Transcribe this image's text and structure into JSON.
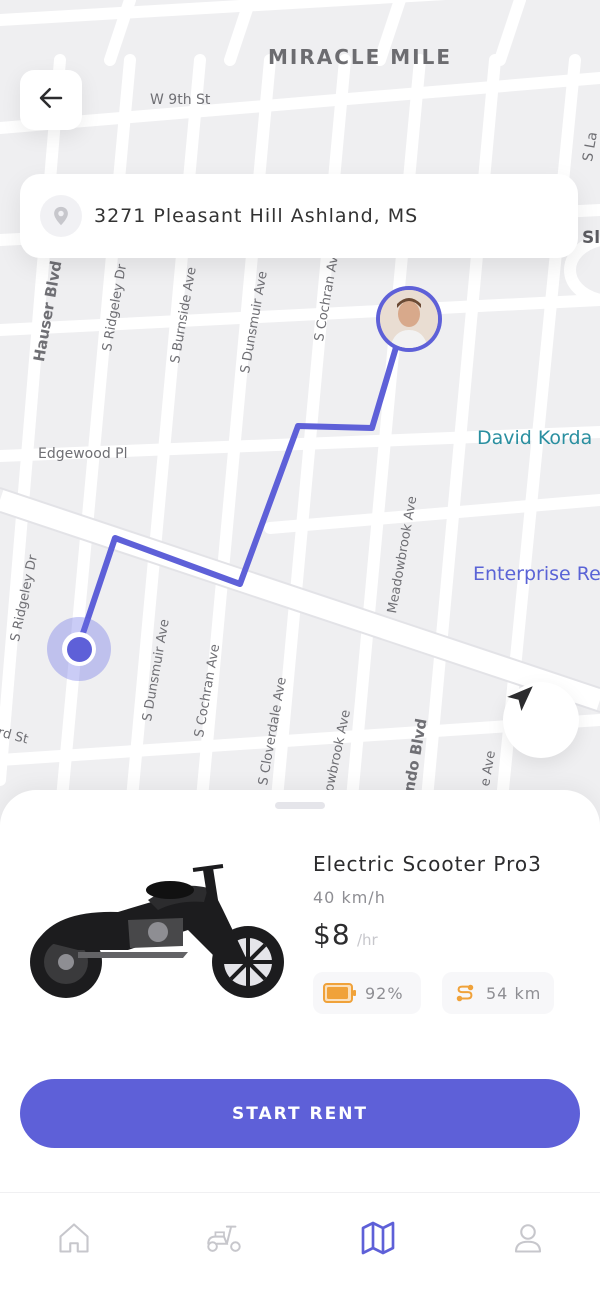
{
  "map": {
    "district": "MIRACLE MILE",
    "streets": [
      "W 9th St",
      "Hauser Blvd",
      "S Ridgeley Dr",
      "S Burnside Ave",
      "S Dunsmuir Ave",
      "S Cochran Ave",
      "Edgewood Pl",
      "Meadowbrook Ave",
      "S Ridgeley Dr",
      "S Dunsmuir Ave",
      "S Cochran Ave",
      "S Cloverdale Ave",
      "owbrook Ave",
      "ndo Blvd",
      "rd St",
      "S La",
      "Sl",
      "e Ave"
    ],
    "places": [
      "David Korda",
      "Enterprise Re"
    ],
    "route_color": "#5e60d8"
  },
  "search": {
    "address": "3271 Pleasant Hill Ashland, MS"
  },
  "vehicle": {
    "name": "Electric Scooter Pro3",
    "speed": "40 km/h",
    "price": "$8",
    "price_unit": "/hr",
    "battery": "92%",
    "range": "54 km"
  },
  "actions": {
    "start_label": "START RENT"
  },
  "tabs": [
    {
      "icon": "home-icon",
      "active": false
    },
    {
      "icon": "scooter-icon",
      "active": false
    },
    {
      "icon": "map-icon",
      "active": true
    },
    {
      "icon": "user-icon",
      "active": false
    }
  ],
  "colors": {
    "accent": "#5e60d8",
    "battery": "#f0a23a",
    "place_teal": "#2a8fa0",
    "place_blue": "#5a63d6"
  }
}
